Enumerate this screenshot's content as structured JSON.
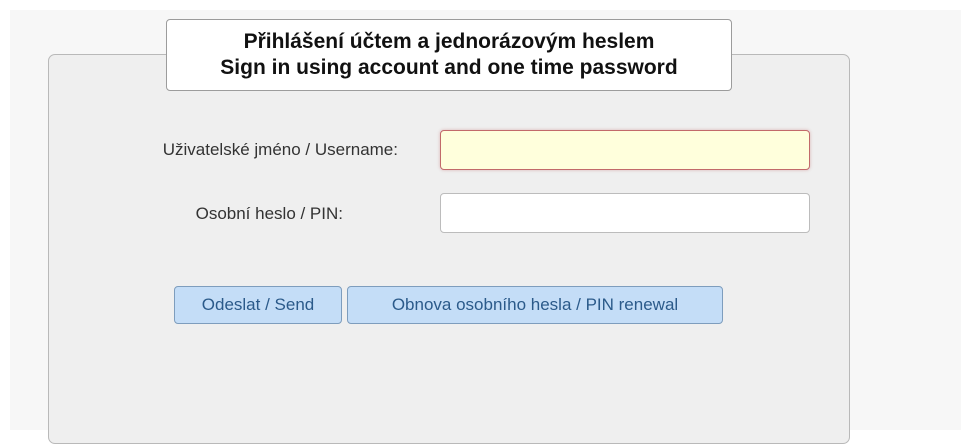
{
  "login": {
    "legend_cz": "Přihlášení účtem a jednorázovým heslem",
    "legend_en": "Sign in using account and one time password",
    "username_label": "Uživatelské jméno / Username:",
    "username_value": "",
    "pin_label": "Osobní heslo / PIN:",
    "pin_value": "",
    "send_button": "Odeslat / Send",
    "renew_button": "Obnova osobního hesla / PIN renewal"
  },
  "colors": {
    "panel_bg": "#efefef",
    "username_field_bg": "#ffffdc",
    "username_field_border": "#c26a6a",
    "button_bg": "#c4ddf7",
    "button_text": "#2b5a8a"
  }
}
